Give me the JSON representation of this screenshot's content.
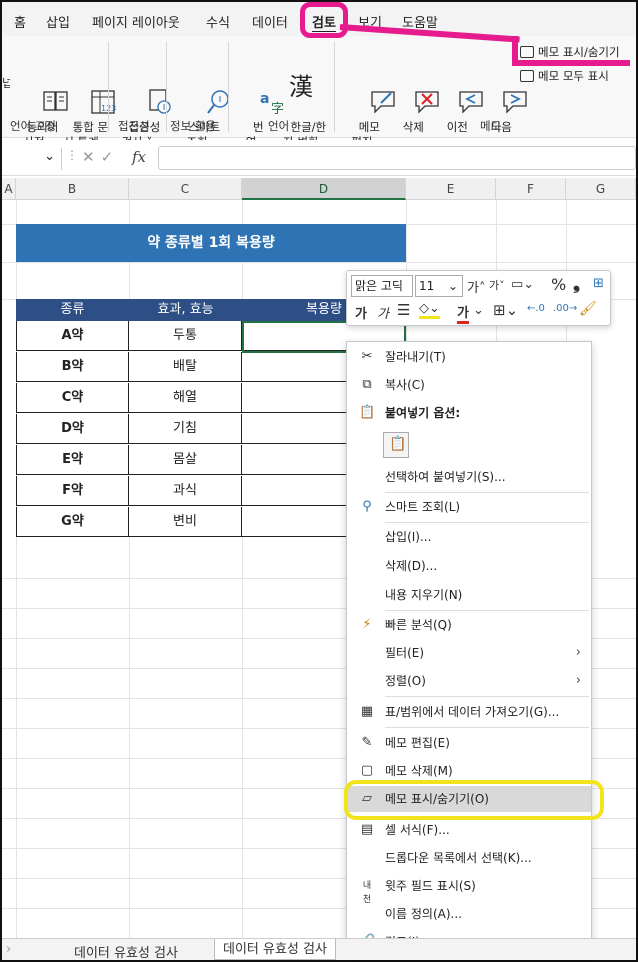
{
  "ribbon_tabs": [
    "홈",
    "삽입",
    "페이지 레이아웃",
    "수식",
    "데이터",
    "검토",
    "보기",
    "도움말"
  ],
  "ribbon": {
    "groups": {
      "proofing": "언어 교정",
      "accessibility": "접근성",
      "insights": "정보 활용",
      "language": "언어",
      "notes": "메모"
    },
    "buttons": {
      "thesaurus": "동의어\n사전",
      "workbook_stats": "통합 문\n서 통계",
      "check_access": "접근성\n검사 ˅",
      "smart_lookup": "스마트\n조회",
      "translate": "번\n역",
      "hanja": "한글/한\n자 변환",
      "edit_note": "메모\n편집",
      "delete": "삭제",
      "previous": "이전",
      "next": "다음",
      "show_hide_note": "메모 표시/숨기기",
      "show_all_notes": "메모 모두 표시",
      "left_cut": "넙"
    }
  },
  "formula_bar": {
    "fx": "fx"
  },
  "columns": [
    "A",
    "B",
    "C",
    "D",
    "E",
    "F",
    "G"
  ],
  "sheet": {
    "title": "약 종류별 1회 복용량",
    "headers": [
      "종류",
      "효과, 효능",
      "복용량"
    ],
    "rows": [
      {
        "kind": "A약",
        "effect": "두통"
      },
      {
        "kind": "B약",
        "effect": "배탈"
      },
      {
        "kind": "C약",
        "effect": "해열"
      },
      {
        "kind": "D약",
        "effect": "기침"
      },
      {
        "kind": "E약",
        "effect": "몸살"
      },
      {
        "kind": "F약",
        "effect": "과식"
      },
      {
        "kind": "G약",
        "effect": "변비"
      }
    ]
  },
  "mini_toolbar": {
    "font": "맑은 고딕",
    "size": "11",
    "grow": "가˄",
    "shrink": "가˅",
    "percent": "%",
    "comma": "❟",
    "bold": "가",
    "italic": "가",
    "font_color_glyph": "가"
  },
  "context_menu": {
    "cut": "잘라내기(T)",
    "copy": "복사(C)",
    "paste_options": "붙여넣기 옵션:",
    "paste_special": "선택하여 붙여넣기(S)...",
    "smart_lookup": "스마트 조회(L)",
    "insert": "삽입(I)...",
    "delete": "삭제(D)...",
    "clear": "내용 지우기(N)",
    "quick_analysis": "빠른 분석(Q)",
    "filter": "필터(E)",
    "sort": "정렬(O)",
    "get_data": "표/범위에서 데이터 가져오기(G)...",
    "edit_note": "메모 편집(E)",
    "delete_note": "메모 삭제(M)",
    "show_hide_note": "메모 표시/숨기기(O)",
    "format_cells": "셀 서식(F)...",
    "pick_list": "드롭다운 목록에서 선택(K)...",
    "phonetic": "윗주 필드 표시(S)",
    "define_name": "이름 정의(A)...",
    "link": "링크(I)"
  },
  "sheet_tabs": [
    "데이터 유효성 검사",
    "데이터 유효성 검사"
  ],
  "colors": {
    "title_band": "#2e74b5",
    "table_header": "#2e4f86",
    "excel_green": "#217346",
    "magenta": "#e61c8e",
    "yellow": "#f1e41a"
  }
}
